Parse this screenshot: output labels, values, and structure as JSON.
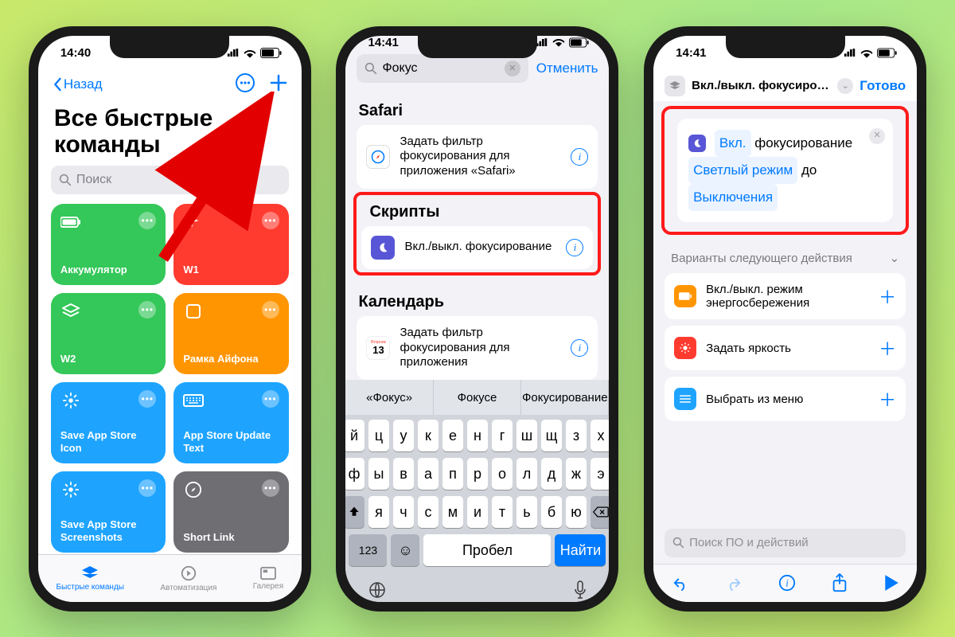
{
  "status": {
    "t1": "14:40",
    "t2": "14:41",
    "t3": "14:41",
    "battery": "71"
  },
  "p1": {
    "back": "Назад",
    "title": "Все быстрые команды",
    "search_ph": "Поиск",
    "tiles": [
      {
        "label": "Аккумулятор"
      },
      {
        "label": "W1"
      },
      {
        "label": "W2"
      },
      {
        "label": "Рамка Айфона"
      },
      {
        "label": "Save App Store Icon"
      },
      {
        "label": "App Store Update Text"
      },
      {
        "label": "Save App Store Screenshots"
      },
      {
        "label": "Short Link"
      }
    ],
    "tabs": {
      "a": "Быстрые команды",
      "b": "Автоматизация",
      "c": "Галерея"
    }
  },
  "p2": {
    "query": "Фокус",
    "cancel": "Отменить",
    "s_safari": "Safari",
    "safari_row": "Задать фильтр фокусирования для приложения «Safari»",
    "s_scripts": "Скрипты",
    "scripts_row": "Вкл./выкл. фокусирование",
    "s_cal": "Календарь",
    "cal_row": "Задать фильтр фокусирования для приложения",
    "cal_day": "13",
    "cal_wd": "Вторник",
    "sugg": [
      "«Фокус»",
      "Фокусе",
      "Фокусирование"
    ],
    "rows": [
      [
        "й",
        "ц",
        "у",
        "к",
        "е",
        "н",
        "г",
        "ш",
        "щ",
        "з",
        "х"
      ],
      [
        "ф",
        "ы",
        "в",
        "а",
        "п",
        "р",
        "о",
        "л",
        "д",
        "ж",
        "э"
      ],
      [
        "я",
        "ч",
        "с",
        "м",
        "и",
        "т",
        "ь",
        "б",
        "ю"
      ]
    ],
    "k123": "123",
    "space": "Пробел",
    "find": "Найти"
  },
  "p3": {
    "title": "Вкл./выкл. фокусирован…",
    "done": "Готово",
    "act": {
      "on": "Вкл.",
      "focus": "фокусирование",
      "mode": "Светлый режим",
      "until": "до",
      "off": "Выключения"
    },
    "hint": "Варианты следующего действия",
    "rows": [
      {
        "t": "Вкл./выкл. режим энергосбережения",
        "c": "#ff9500"
      },
      {
        "t": "Задать яркость",
        "c": "#ff3b30"
      },
      {
        "t": "Выбрать из меню",
        "c": "#1ea4ff"
      }
    ],
    "search_ph": "Поиск ПО и действий"
  }
}
